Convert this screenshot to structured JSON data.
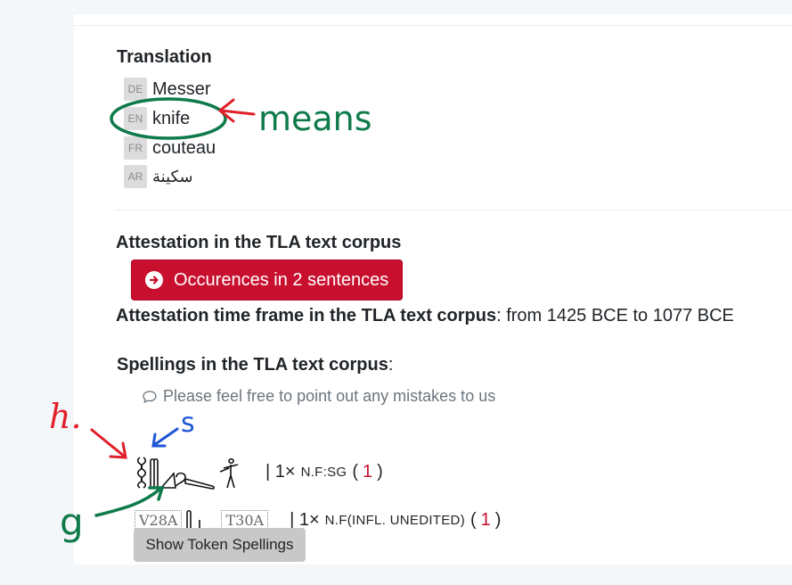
{
  "translation": {
    "heading": "Translation",
    "items": [
      {
        "lang": "DE",
        "text": "Messer"
      },
      {
        "lang": "EN",
        "text": "knife"
      },
      {
        "lang": "FR",
        "text": "couteau"
      },
      {
        "lang": "AR",
        "text": "سكينة"
      }
    ]
  },
  "attestation": {
    "heading": "Attestation in the TLA text corpus",
    "button_label": "Occurences in 2 sentences",
    "timeframe_label": "Attestation time frame in the TLA text corpus",
    "timeframe_value": ": from 1425 BCE to 1077 BCE"
  },
  "spellings": {
    "heading": "Spellings in the TLA text corpus",
    "heading_suffix": ":",
    "hint": "Please feel free to point out any mistakes to us",
    "rows": [
      {
        "prefix": "| 1×",
        "gram": "N.F:SG",
        "open": "(",
        "count": "1",
        "close": ")"
      },
      {
        "code1": "V28A",
        "code2": "T30A",
        "prefix": "| 1×",
        "gram": "N.F(INFL. UNEDITED)",
        "open": "(",
        "count": "1",
        "close": ")"
      }
    ],
    "show_button": "Show Token Spellings"
  },
  "annotations": {
    "means": "means",
    "h": "h.",
    "s": "s",
    "g": "g",
    "colors": {
      "red": "#e0202a",
      "green": "#0f7a4a",
      "blue": "#1e56d6"
    }
  },
  "colors": {
    "accent": "#c8102e",
    "badge_bg": "#dcdcdc",
    "muted": "#6c757d"
  }
}
